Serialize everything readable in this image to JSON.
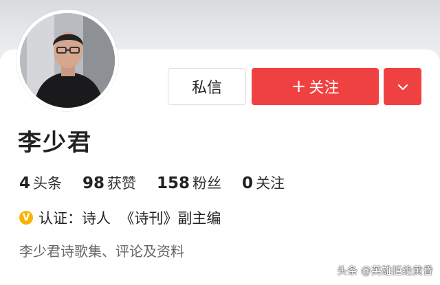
{
  "profile": {
    "name": "李少君",
    "avatar_icon": "person-photo",
    "certification": {
      "badge_letter": "V",
      "text": "认证：诗人  《诗刊》副主编"
    },
    "description": "李少君诗歌集、评论及资料"
  },
  "actions": {
    "message_label": "私信",
    "follow_plus": "+",
    "follow_label": "关注",
    "more_icon": "chevron-down-icon"
  },
  "stats": [
    {
      "value": "4",
      "label": "头条"
    },
    {
      "value": "98",
      "label": "获赞"
    },
    {
      "value": "158",
      "label": "粉丝"
    },
    {
      "value": "0",
      "label": "关注"
    }
  ],
  "watermark": "头条 @英雄拒绝黄昏",
  "colors": {
    "accent": "#f04142",
    "badge": "#f6b400",
    "secondary_text": "#666666"
  }
}
